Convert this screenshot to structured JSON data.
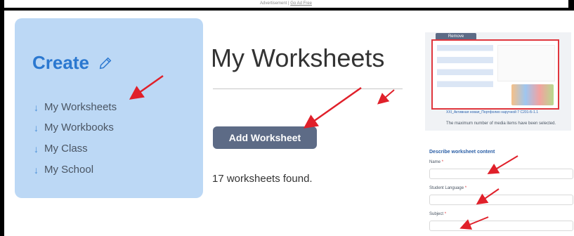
{
  "advertisement": {
    "text": "Advertisement |",
    "link": "Go Ad Free"
  },
  "sidebar": {
    "title": "Create",
    "items": [
      {
        "label": "My Worksheets"
      },
      {
        "label": "My Workbooks"
      },
      {
        "label": "My Class"
      },
      {
        "label": "My School"
      }
    ]
  },
  "main": {
    "heading": "My Worksheets",
    "add_button_label": "Add Worksheet",
    "found_text": "17 worksheets found."
  },
  "media_panel": {
    "remove_label": "Remove",
    "thumbnail_caption": "XXI_Активная новая_Портфолио наручной 7 С201-Б-1.1",
    "max_message": "The maximum number of media items have been selected."
  },
  "form": {
    "heading": "Describe worksheet content",
    "fields": [
      {
        "label": "Name",
        "required_mark": "*"
      },
      {
        "label": "Student Language",
        "required_mark": "*"
      },
      {
        "label": "Subject",
        "required_mark": "*"
      }
    ]
  },
  "colors": {
    "annotation_arrow": "#e0202a",
    "accent": "#2b78d0",
    "button": "#5d6b86",
    "card": "#bcd8f5"
  },
  "icons": [
    "pencil-icon",
    "arrow-down-icon"
  ]
}
